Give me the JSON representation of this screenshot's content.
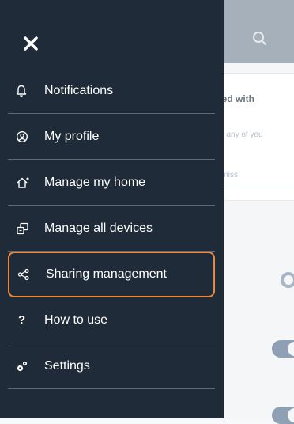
{
  "background": {
    "card_title": "hared with",
    "card_subtitle": "es to any of you",
    "card_action": ", dismiss"
  },
  "drawer": {
    "close_icon": "close-icon",
    "items": [
      {
        "label": "Notifications",
        "icon": "bell-icon"
      },
      {
        "label": "My profile",
        "icon": "profile-icon"
      },
      {
        "label": "Manage my home",
        "icon": "home-icon"
      },
      {
        "label": "Manage all devices",
        "icon": "devices-icon"
      },
      {
        "label": "Sharing management",
        "icon": "share-icon",
        "highlighted": true
      },
      {
        "label": "How to use",
        "icon": "help-icon"
      },
      {
        "label": "Settings",
        "icon": "settings-icon"
      }
    ]
  },
  "colors": {
    "drawer_bg": "#1f2b38",
    "highlight": "#f0883a",
    "divider": "#5d6a78",
    "text": "#ffffff"
  }
}
